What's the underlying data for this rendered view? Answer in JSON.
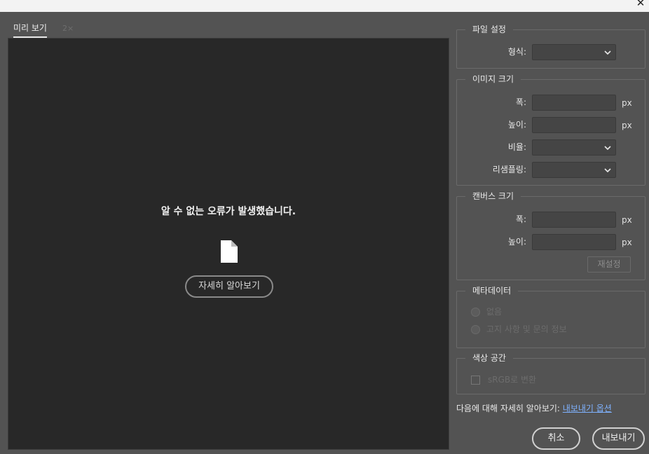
{
  "window": {
    "close_symbol": "✕"
  },
  "tabs": [
    {
      "label": "미리 보기",
      "active": true
    },
    {
      "label": "2×",
      "active": false
    }
  ],
  "preview": {
    "error_message": "알 수 없는 오류가 발생했습니다.",
    "icon": "document-icon",
    "learn_more_label": "자세히 알아보기"
  },
  "file_settings": {
    "title": "파일 설정",
    "format_label": "형식:",
    "format_value": ""
  },
  "image_size": {
    "title": "이미지 크기",
    "width_label": "폭:",
    "width_value": "",
    "height_label": "높이:",
    "height_value": "",
    "scale_label": "비율:",
    "scale_value": "",
    "resample_label": "리샘플링:",
    "resample_value": "",
    "unit": "px"
  },
  "canvas_size": {
    "title": "캔버스 크기",
    "width_label": "폭:",
    "width_value": "",
    "height_label": "높이:",
    "height_value": "",
    "unit": "px",
    "reset_label": "재설정"
  },
  "metadata": {
    "title": "메타데이터",
    "options": [
      {
        "label": "없음",
        "selected": false
      },
      {
        "label": "고지 사항 및 문의 정보",
        "selected": false
      }
    ]
  },
  "color_space": {
    "title": "색상 공간",
    "convert_srgb_label": "sRGB로 변환",
    "convert_srgb_checked": false
  },
  "footer": {
    "note": "다음에 대해 자세히 알아보기: ",
    "link": "내보내기 옵션",
    "cancel_label": "취소",
    "export_label": "내보내기"
  },
  "colors": {
    "panel_bg": "#535353",
    "preview_bg": "#282828",
    "link": "#7fb2ff"
  }
}
